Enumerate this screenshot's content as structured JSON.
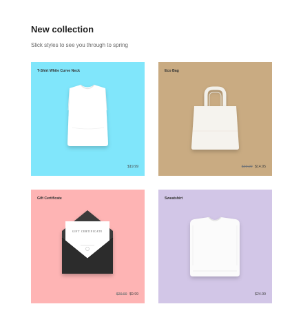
{
  "header": {
    "title": "New collection",
    "subtitle": "Slick styles to see you through to spring"
  },
  "products": [
    {
      "name": "T-Shirt White Curve Neck",
      "price": "$19.99",
      "old_price": "",
      "bg": "#80e6fb",
      "icon": "folded-tshirt-icon"
    },
    {
      "name": "Eco Bag",
      "old_price": "$20.00",
      "price": "$14.95",
      "bg": "#c9ab82",
      "icon": "tote-bag-icon"
    },
    {
      "name": "Gift Certificate",
      "old_price": "$20.00",
      "price": "$9.99",
      "bg": "#feb4b4",
      "icon": "envelope-card-icon",
      "card_text": "GIFT CERTIFICATE"
    },
    {
      "name": "Sweatshirt",
      "price": "$24.99",
      "old_price": "",
      "bg": "#d2c6e7",
      "icon": "folded-sweatshirt-icon"
    }
  ]
}
